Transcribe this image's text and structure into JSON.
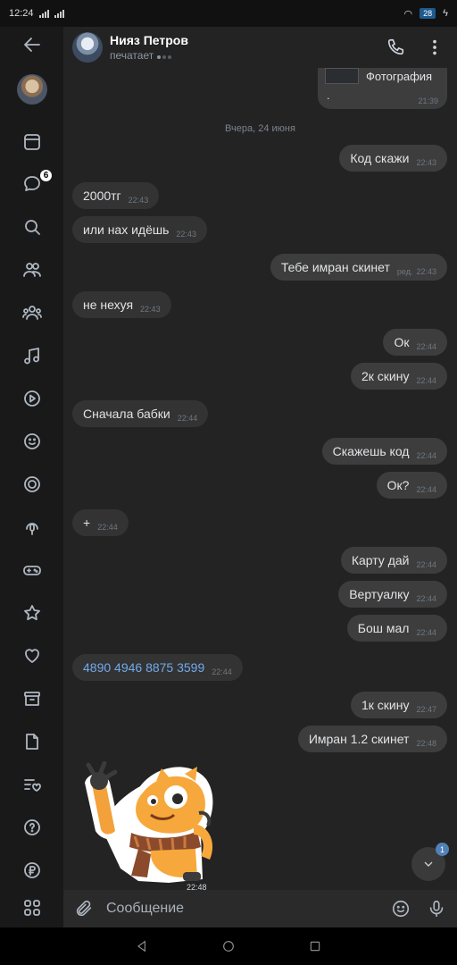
{
  "status_bar": {
    "time": "12:24",
    "battery": "28"
  },
  "sidebar": {
    "messages_badge": "6"
  },
  "header": {
    "name": "Нияз Петров",
    "status": "печатает"
  },
  "photo_preview": {
    "label": "Фотография",
    "caption": ".",
    "time": "21:39"
  },
  "date_separator": "Вчера, 24 июня",
  "messages": [
    {
      "dir": "out",
      "text": "Код скажи",
      "time": "22:43",
      "edited": ""
    },
    {
      "dir": "in",
      "text": "2000тг",
      "time": "22:43",
      "edited": ""
    },
    {
      "dir": "in",
      "text": "или нах идёшь",
      "time": "22:43",
      "edited": ""
    },
    {
      "dir": "out",
      "text": "Тебе имран скинет",
      "time": "22:43",
      "edited": "ред."
    },
    {
      "dir": "in",
      "text": "не нехуя",
      "time": "22:43",
      "edited": ""
    },
    {
      "dir": "out",
      "text": "Ок",
      "time": "22:44",
      "edited": ""
    },
    {
      "dir": "out",
      "text": "2к скину",
      "time": "22:44",
      "edited": ""
    },
    {
      "dir": "in",
      "text": "Сначала бабки",
      "time": "22:44",
      "edited": ""
    },
    {
      "dir": "out",
      "text": "Скажешь код",
      "time": "22:44",
      "edited": ""
    },
    {
      "dir": "out",
      "text": "Ок?",
      "time": "22:44",
      "edited": ""
    },
    {
      "dir": "in",
      "text": "+",
      "time": "22:44",
      "edited": ""
    },
    {
      "dir": "out",
      "text": "Карту дай",
      "time": "22:44",
      "edited": ""
    },
    {
      "dir": "out",
      "text": "Вертуалку",
      "time": "22:44",
      "edited": ""
    },
    {
      "dir": "out",
      "text": "Бош мал",
      "time": "22:44",
      "edited": ""
    },
    {
      "dir": "in",
      "text": "4890 4946 8875 3599",
      "time": "22:44",
      "edited": "",
      "link": true
    },
    {
      "dir": "out",
      "text": "1к скину",
      "time": "22:47",
      "edited": ""
    },
    {
      "dir": "out",
      "text": "Имран 1.2 скинет",
      "time": "22:48",
      "edited": ""
    }
  ],
  "sticker": {
    "time": "22:48"
  },
  "scroll_button": {
    "badge": "1"
  },
  "composer": {
    "placeholder": "Сообщение"
  }
}
